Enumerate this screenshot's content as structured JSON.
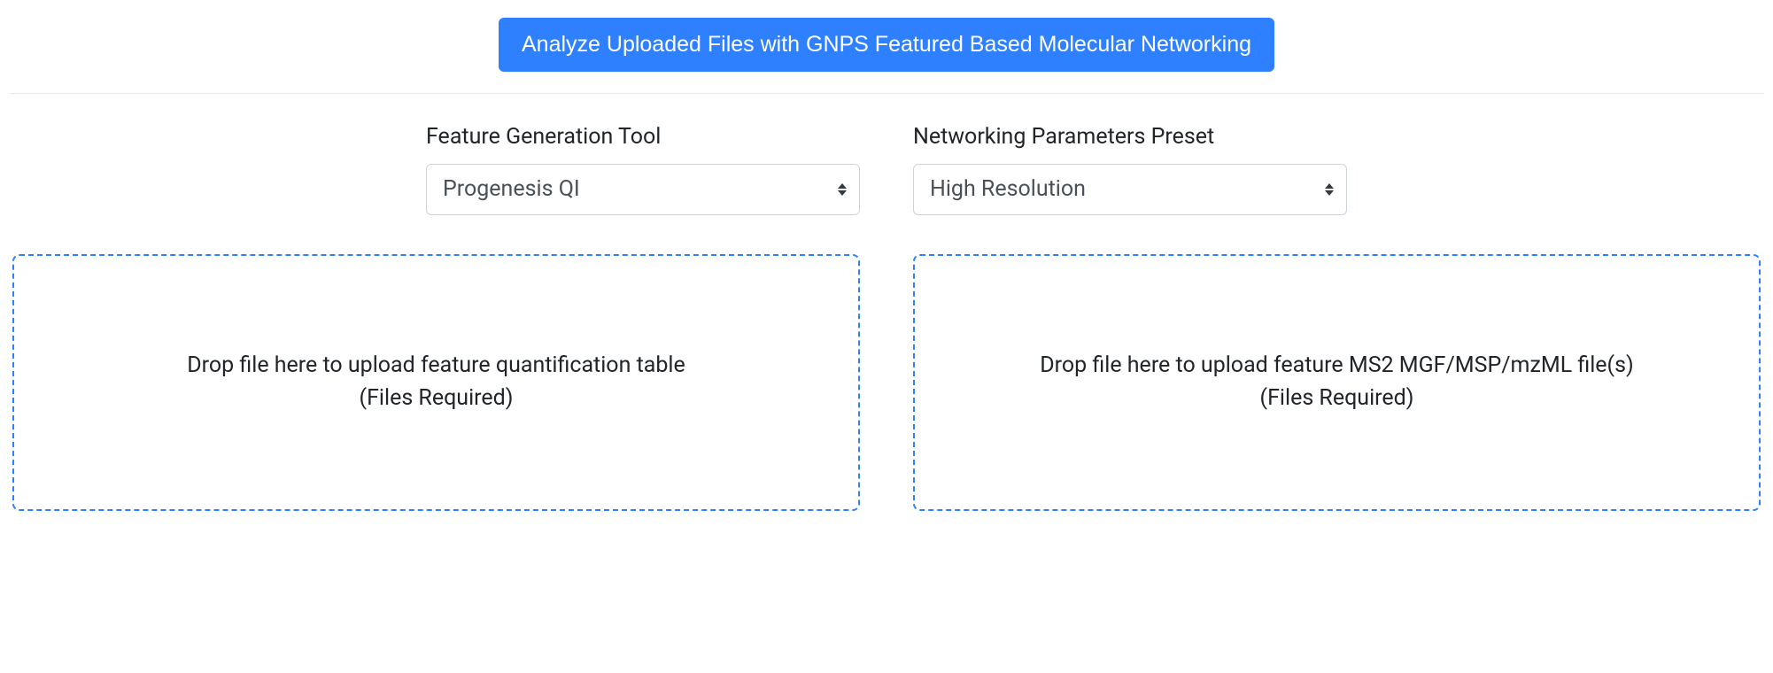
{
  "header": {
    "analyze_button_label": "Analyze Uploaded Files with GNPS Featured Based Molecular Networking"
  },
  "controls": {
    "feature_tool": {
      "label": "Feature Generation Tool",
      "selected": "Progenesis QI"
    },
    "network_preset": {
      "label": "Networking Parameters Preset",
      "selected": "High Resolution"
    }
  },
  "dropzones": {
    "quant_table": {
      "main_text": "Drop file here to upload feature quantification table",
      "sub_text": "(Files Required)"
    },
    "ms2_files": {
      "main_text": "Drop file here to upload feature MS2 MGF/MSP/mzML file(s)",
      "sub_text": "(Files Required)"
    }
  }
}
